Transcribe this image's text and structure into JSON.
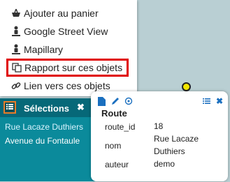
{
  "menu": {
    "items": [
      {
        "label": "Ajouter au panier",
        "icon": "basket-icon"
      },
      {
        "label": "Google Street View",
        "icon": "person-icon"
      },
      {
        "label": "Mapillary",
        "icon": "person-icon"
      },
      {
        "label": "Rapport sur ces objets",
        "icon": "copy-icon"
      },
      {
        "label": "Lien vers ces objets",
        "icon": "link-icon"
      }
    ]
  },
  "selection": {
    "title": "Sélections",
    "close": "✖",
    "items": [
      "Rue Lacaze Duthiers",
      "Avenue du Fontaule"
    ]
  },
  "popup": {
    "title": "Route",
    "attributes": [
      {
        "key": "route_id",
        "value": "18"
      },
      {
        "key": "nom",
        "value": "Rue Lacaze Duthiers"
      },
      {
        "key": "auteur",
        "value": "demo"
      }
    ],
    "close": "✖"
  },
  "colors": {
    "accent": "#0b8a9b",
    "header": "#066878",
    "highlight": "#e00000",
    "toggle_border": "#e97c28",
    "icon_blue": "#1a6fbf",
    "marker": "#f2e600"
  }
}
